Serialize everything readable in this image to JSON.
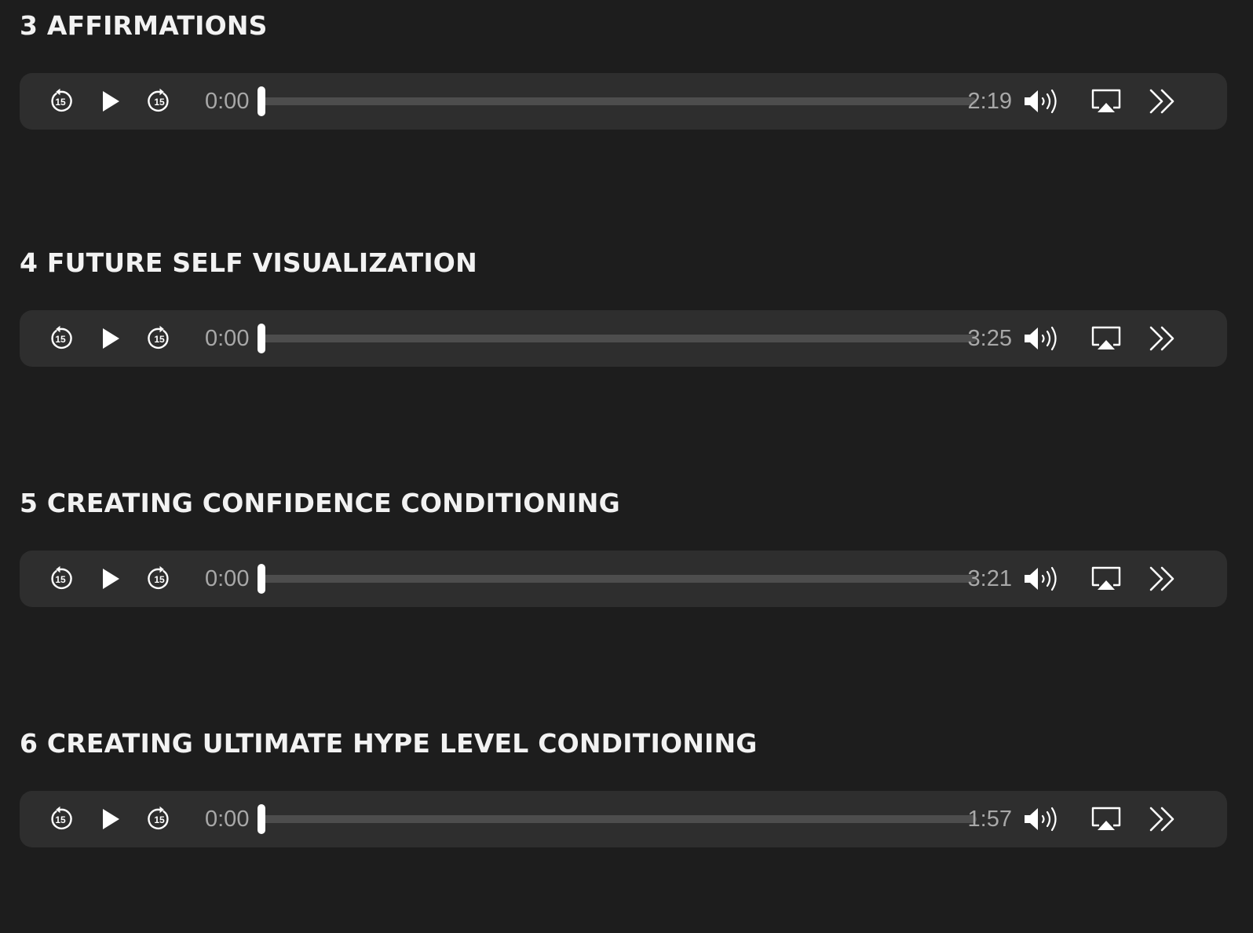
{
  "tracks": [
    {
      "title": "3 AFFIRMATIONS",
      "current_time": "0:00",
      "duration": "2:19",
      "progress": 0
    },
    {
      "title": "4 FUTURE SELF VISUALIZATION",
      "current_time": "0:00",
      "duration": "3:25",
      "progress": 0
    },
    {
      "title": "5 CREATING CONFIDENCE CONDITIONING",
      "current_time": "0:00",
      "duration": "3:21",
      "progress": 0
    },
    {
      "title": "6 CREATING ULTIMATE HYPE LEVEL CONDITIONING",
      "current_time": "0:00",
      "duration": "1:57",
      "progress": 0
    }
  ],
  "controls": {
    "skip_seconds": "15",
    "icons": {
      "skip_back": "skip-back-15-icon",
      "play": "play-icon",
      "skip_forward": "skip-forward-15-icon",
      "volume": "volume-icon",
      "airplay": "airplay-icon",
      "playback_rate": "double-chevron-right-icon"
    }
  },
  "colors": {
    "background": "#1d1d1d",
    "player_background": "#2e2e2e",
    "title": "#f2f2f2",
    "time_text": "#a8a8a8",
    "rail": "#4d4d4d",
    "thumb": "#ffffff",
    "icon": "#ffffff"
  }
}
